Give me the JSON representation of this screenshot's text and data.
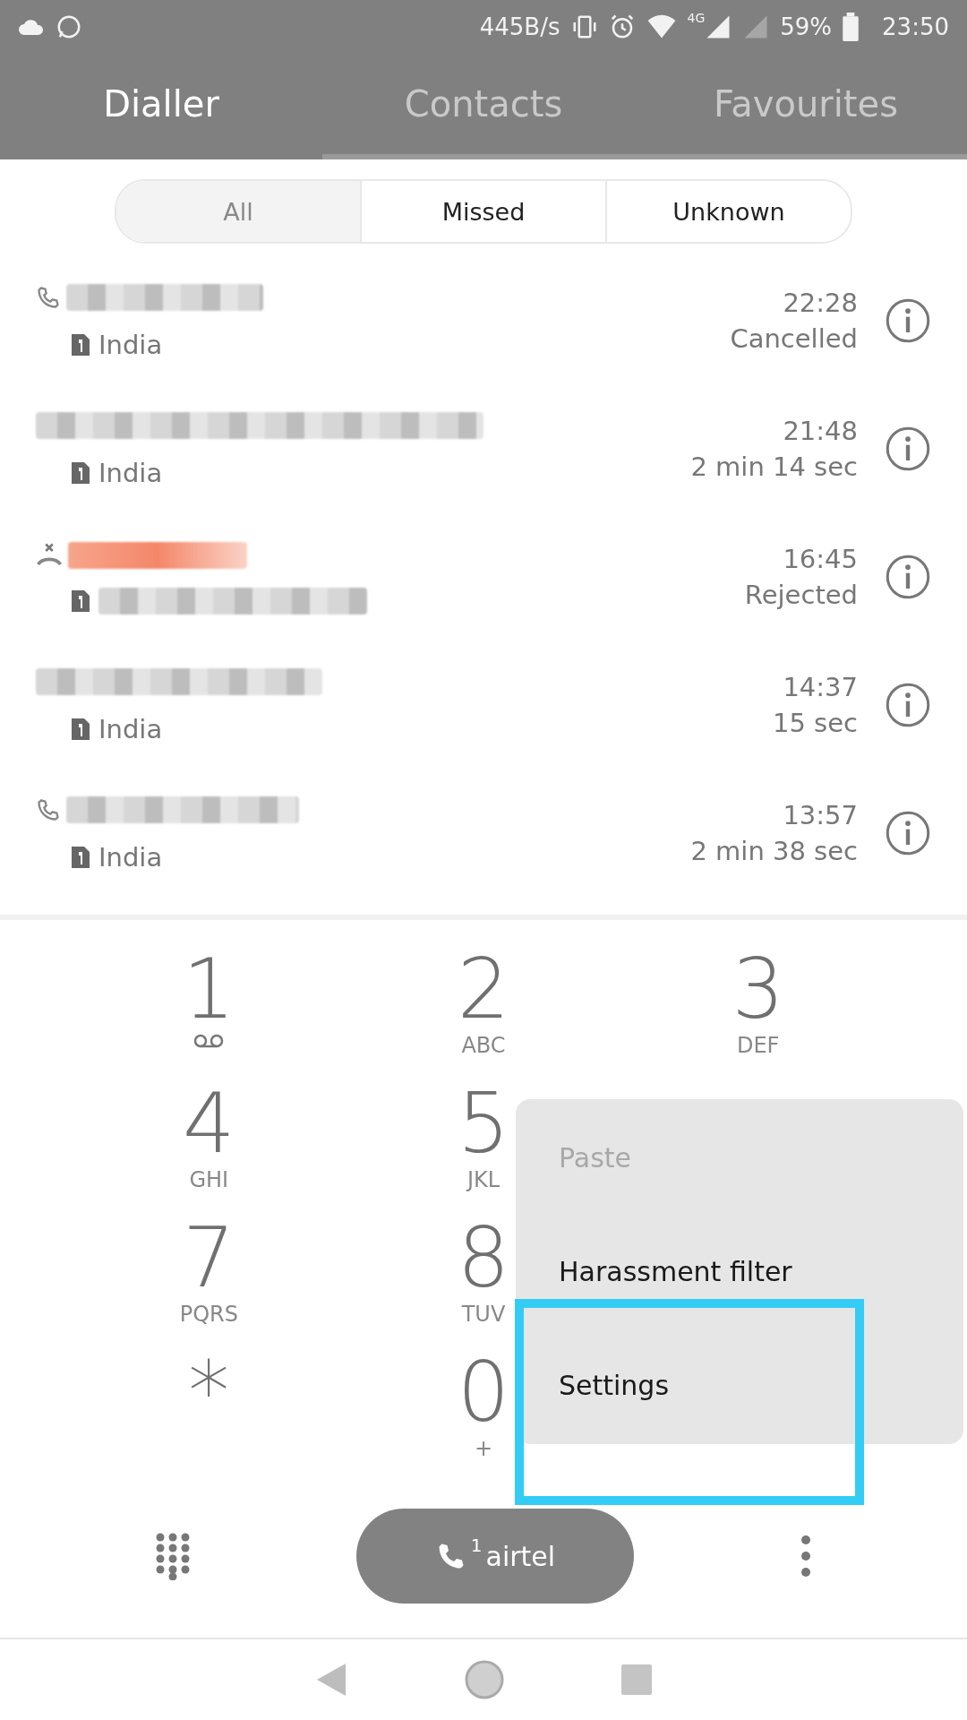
{
  "status_bar": {
    "speed": "445B/s",
    "network": "4G",
    "battery": "59%",
    "time": "23:50"
  },
  "tabs": [
    {
      "label": "Dialler",
      "selected": true
    },
    {
      "label": "Contacts",
      "selected": false
    },
    {
      "label": "Favourites",
      "selected": false
    }
  ],
  "filters": [
    {
      "label": "All",
      "selected": true
    },
    {
      "label": "Missed",
      "selected": false
    },
    {
      "label": "Unknown",
      "selected": false
    }
  ],
  "calls": [
    {
      "kind": "outgoing",
      "missed": false,
      "location": "India",
      "time": "22:28",
      "detail": "Cancelled"
    },
    {
      "kind": "plain",
      "missed": false,
      "location": "India",
      "time": "21:48",
      "detail": "2 min 14 sec"
    },
    {
      "kind": "missed",
      "missed": true,
      "time": "16:45",
      "detail": "Rejected"
    },
    {
      "kind": "plain",
      "missed": false,
      "location": "India",
      "time": "14:37",
      "detail": "15 sec"
    },
    {
      "kind": "outgoing",
      "missed": false,
      "location": "India",
      "time": "13:57",
      "detail": "2 min 38 sec"
    }
  ],
  "keypad": [
    [
      {
        "digit": "1",
        "kind": "voicemail"
      },
      {
        "digit": "2",
        "letters": "ABC"
      },
      {
        "digit": "3",
        "letters": "DEF"
      }
    ],
    [
      {
        "digit": "4",
        "letters": "GHI"
      },
      {
        "digit": "5",
        "letters": "JKL"
      }
    ],
    [
      {
        "digit": "7",
        "letters": "PQRS"
      },
      {
        "digit": "8",
        "letters": "TUV"
      }
    ],
    [
      {
        "digit": "*"
      },
      {
        "digit": "0",
        "letters": "+"
      }
    ]
  ],
  "call_button": {
    "sim": "1",
    "carrier": "airtel"
  },
  "menu": [
    {
      "label": "Paste",
      "disabled": true,
      "highlighted": false
    },
    {
      "label": "Harassment filter",
      "disabled": false,
      "highlighted": false
    },
    {
      "label": "Settings",
      "disabled": false,
      "highlighted": true
    }
  ]
}
